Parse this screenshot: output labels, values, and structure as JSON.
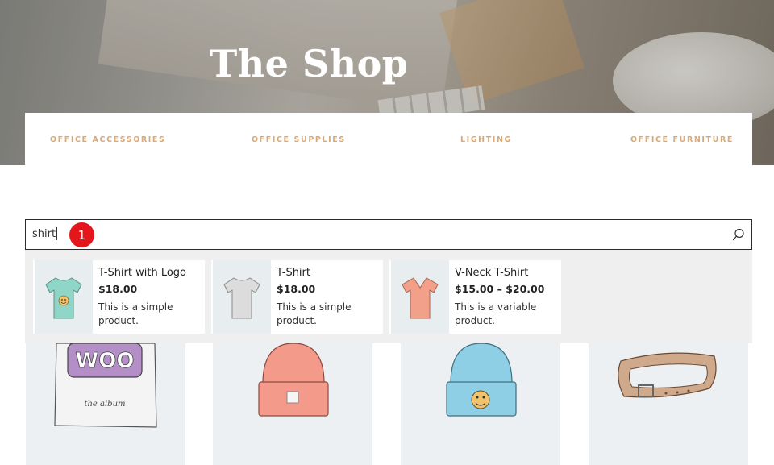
{
  "hero": {
    "title": "The Shop"
  },
  "categories": [
    {
      "label": "OFFICE ACCESSORIES"
    },
    {
      "label": "OFFICE SUPPLIES"
    },
    {
      "label": "LIGHTING"
    },
    {
      "label": "OFFICE FURNITURE"
    }
  ],
  "search": {
    "value": "shirt",
    "icon": "search-icon",
    "badge": "1"
  },
  "results": [
    {
      "title": "T-Shirt with Logo",
      "price": "$18.00",
      "description": "This is a simple product.",
      "icon": "tshirt-teal-logo-icon"
    },
    {
      "title": "T-Shirt",
      "price": "$18.00",
      "description": "This is a simple product.",
      "icon": "tshirt-gray-icon"
    },
    {
      "title": "V-Neck T-Shirt",
      "price": "$15.00 – $20.00",
      "description": "This is a variable product.",
      "icon": "vneck-tshirt-coral-icon"
    }
  ],
  "products": [
    {
      "name": "woo-album-image"
    },
    {
      "name": "beanie-coral-image"
    },
    {
      "name": "beanie-blue-logo-image"
    },
    {
      "name": "belt-image"
    }
  ],
  "colors": {
    "accent": "#d8a97a",
    "badge": "#e4161c",
    "dropdown_bg": "#efefef",
    "product_bg": "#ecf0f2"
  }
}
